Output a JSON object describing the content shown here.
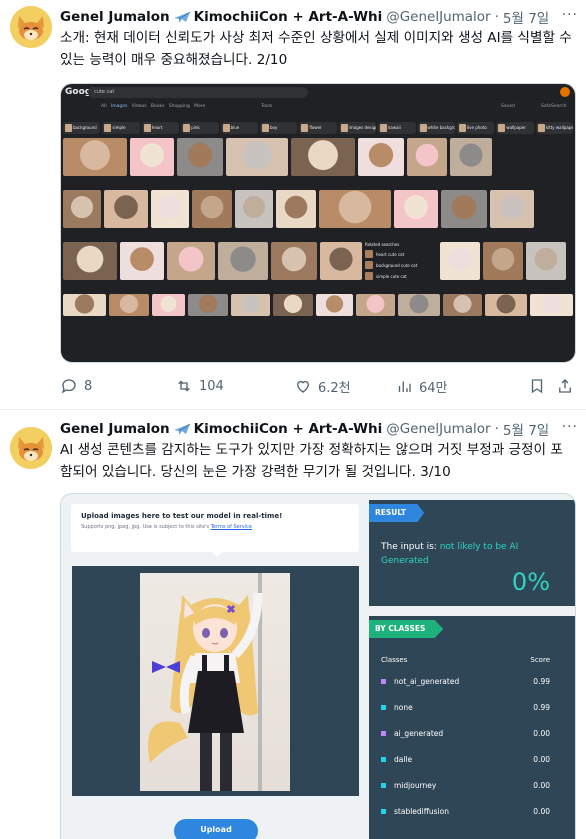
{
  "tweets": [
    {
      "display_name": "Genel Jumalon",
      "name_suffix": "KimochiiCon + Art-A-Whi",
      "handle": "@GenelJumalor",
      "separator": "·",
      "date": "5월 7일",
      "more": "···",
      "text": "소개: 현재 데이터 신뢰도가 사상 최저 수준인 상황에서 실제 이미지와 생성 AI를 식별할 수 있는 능력이 매우 중요해졌습니다. 2/10",
      "actions": {
        "reply": "8",
        "retweet": "104",
        "like": "6.2천",
        "views": "64만"
      }
    },
    {
      "display_name": "Genel Jumalon",
      "name_suffix": "KimochiiCon + Art-A-Whi",
      "handle": "@GenelJumalor",
      "separator": "·",
      "date": "5월 7일",
      "more": "···",
      "text": "AI 생성 콘텐츠를 감지하는 도구가 있지만 가장 정확하지는 않으며 거짓 부정과 긍정이 포함되어 있습니다. 당신의 눈은 가장 강력한 무기가 될 것입니다. 3/10"
    }
  ],
  "google": {
    "logo": "Google",
    "query": "cute cat",
    "tabs": [
      "All",
      "Images",
      "Videos",
      "Books",
      "Shopping",
      "More",
      "Tools"
    ],
    "active_tab": "Images",
    "saved": "Saved",
    "safesearch": "SafeSearch",
    "chips": [
      "background",
      "simple",
      "heart",
      "pink",
      "blue",
      "boy",
      "flower",
      "images design",
      "kawaii",
      "white background",
      "live photo",
      "wallpaper",
      "kitty wallpaper"
    ],
    "related": {
      "title": "Related searches",
      "items": [
        "heart cute cat",
        "background cute cat",
        "simple cute cat"
      ]
    }
  },
  "detector": {
    "upload_title": "Upload images here to test our model in real-time!",
    "upload_sub": "Supports png, jpeg, jpg. Use is subject to this site's",
    "tos": "Terms of Service",
    "upload_button": "Upload",
    "result_tag": "RESULT",
    "verdict_prefix": "The input is:",
    "verdict_highlight": "not likely to be AI Generated",
    "percent": "0%",
    "classes_tag": "BY CLASSES",
    "col_classes": "Classes",
    "col_score": "Score",
    "classes": [
      {
        "name": "not_ai_generated",
        "score": "0.99",
        "color": "#c084fc"
      },
      {
        "name": "none",
        "score": "0.99",
        "color": "#22d3ee"
      },
      {
        "name": "ai_generated",
        "score": "0.00",
        "color": "#c084fc"
      },
      {
        "name": "dalle",
        "score": "0.00",
        "color": "#22d3ee"
      },
      {
        "name": "midjourney",
        "score": "0.00",
        "color": "#22d3ee"
      },
      {
        "name": "stablediffusion",
        "score": "0.00",
        "color": "#22d3ee"
      }
    ]
  },
  "colors": {
    "link_blue": "#1d9bf0",
    "muted": "#536471",
    "panel": "#2f4656",
    "teal": "#2dd4bf"
  }
}
